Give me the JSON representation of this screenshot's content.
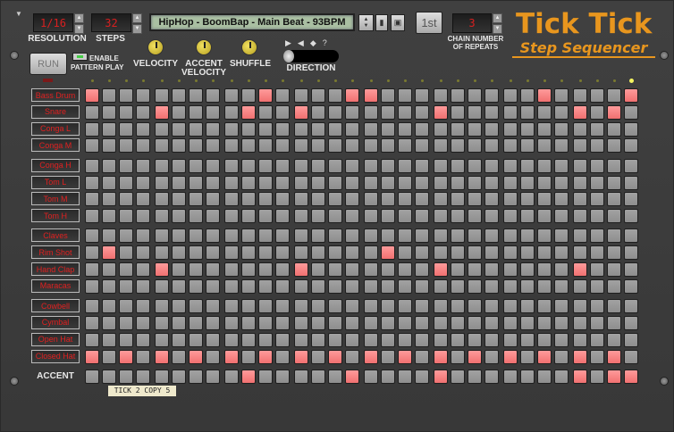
{
  "header": {
    "resolution": {
      "value": "1/16",
      "label": "RESOLUTION"
    },
    "steps": {
      "value": "32",
      "label": "STEPS"
    },
    "pattern_name": "HipHop - BoomBap - Main Beat - 93BPM",
    "first_button": "1st",
    "chain": {
      "value": "3",
      "label_line1": "CHAIN NUMBER",
      "label_line2": "OF REPEATS"
    },
    "logo_line1": "Tick Tick",
    "logo_line2": "Step Sequencer"
  },
  "controls": {
    "run_label": "RUN",
    "enable_line1": "ENABLE",
    "enable_line2": "PATTERN PLAY",
    "velocity_label": "VELOCITY",
    "accent_velocity_line1": "ACCENT",
    "accent_velocity_line2": "VELOCITY",
    "shuffle_label": "SHUFFLE",
    "direction_label": "DIRECTION",
    "direction_icons": [
      "▶",
      "◀",
      "◆",
      "?"
    ]
  },
  "grid": {
    "current_step": 31,
    "rows": [
      {
        "name": "Bass Drum",
        "on": [
          0,
          10,
          15,
          16,
          26,
          31
        ]
      },
      {
        "name": "Snare",
        "on": [
          4,
          9,
          12,
          20,
          28,
          30
        ]
      },
      {
        "name": "Conga L",
        "on": []
      },
      {
        "name": "Conga M",
        "on": []
      },
      {
        "name": "Conga H",
        "on": []
      },
      {
        "name": "Tom L",
        "on": []
      },
      {
        "name": "Tom M",
        "on": []
      },
      {
        "name": "Tom H",
        "on": []
      },
      {
        "name": "Claves",
        "on": []
      },
      {
        "name": "Rim Shot",
        "on": [
          1,
          17
        ]
      },
      {
        "name": "Hand Clap",
        "on": [
          4,
          12,
          20,
          28
        ]
      },
      {
        "name": "Maracas",
        "on": []
      },
      {
        "name": "Cowbell",
        "on": []
      },
      {
        "name": "Cymbal",
        "on": []
      },
      {
        "name": "Open Hat",
        "on": []
      },
      {
        "name": "Closed Hat",
        "on": [
          0,
          2,
          4,
          6,
          8,
          10,
          12,
          14,
          16,
          18,
          20,
          22,
          24,
          26,
          28,
          30
        ]
      }
    ],
    "accent": {
      "name": "ACCENT",
      "on": [
        9,
        15,
        20,
        28,
        30,
        31
      ]
    }
  },
  "patch_tag": "TICK 2 COPY 5"
}
